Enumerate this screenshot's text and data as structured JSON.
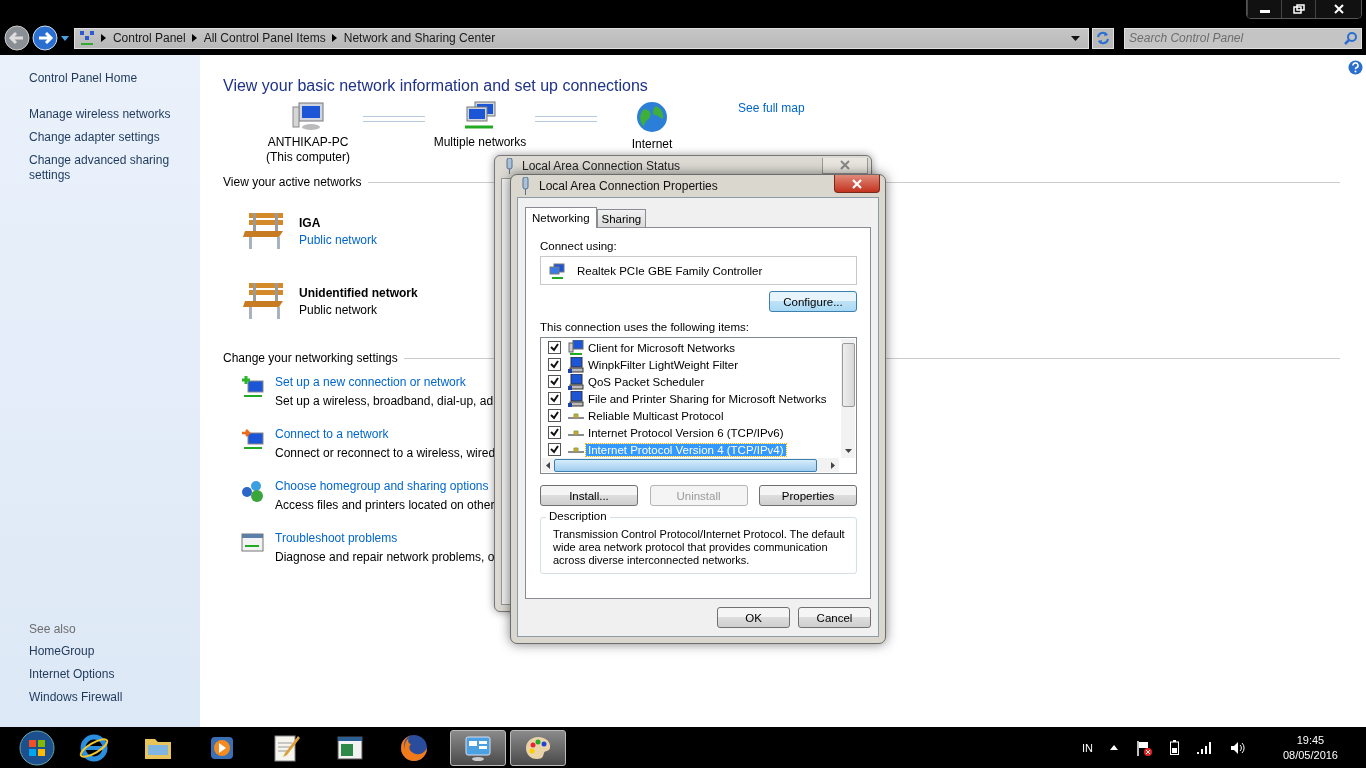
{
  "address_bar": {
    "breadcrumbs": [
      "Control Panel",
      "All Control Panel Items",
      "Network and Sharing Center"
    ]
  },
  "search": {
    "placeholder": "Search Control Panel"
  },
  "sidebar": {
    "items": [
      "Control Panel Home",
      "Manage wireless networks",
      "Change adapter settings",
      "Change advanced sharing settings"
    ],
    "see_also_title": "See also",
    "see_also": [
      "HomeGroup",
      "Internet Options",
      "Windows Firewall"
    ]
  },
  "main": {
    "heading": "View your basic network information and set up connections",
    "map": [
      {
        "kind": "computer",
        "name": "ANTHIKAP-PC",
        "sub": "(This computer)"
      },
      {
        "kind": "networks",
        "name": "Multiple networks"
      },
      {
        "kind": "globe",
        "name": "Internet"
      }
    ],
    "see_full_map": "See full map",
    "active_title": "View your active networks",
    "active_networks": [
      {
        "name": "IGA",
        "type": "Public network",
        "link": true
      },
      {
        "name": "Unidentified network",
        "type": "Public network",
        "link": false
      }
    ],
    "settings_title": "Change your networking settings",
    "tasks": [
      {
        "kind": "new",
        "title": "Set up a new connection or network",
        "desc": "Set up a wireless, broadband, dial-up, ad"
      },
      {
        "kind": "connect",
        "title": "Connect to a network",
        "desc": "Connect or reconnect to a wireless, wired"
      },
      {
        "kind": "homegroup",
        "title": "Choose homegroup and sharing options",
        "desc": "Access files and printers located on other"
      },
      {
        "kind": "troubleshoot",
        "title": "Troubleshoot problems",
        "desc": "Diagnose and repair network problems, o"
      }
    ]
  },
  "status_window": {
    "title": "Local Area Connection Status"
  },
  "dialog": {
    "title": "Local Area Connection Properties",
    "tabs": [
      {
        "label": "Networking",
        "selected": true
      },
      {
        "label": "Sharing",
        "selected": false
      }
    ],
    "connect_using_label": "Connect using:",
    "adapter": "Realtek PCIe GBE Family Controller",
    "configure": "Configure...",
    "items_label": "This connection uses the following items:",
    "items": [
      {
        "kind": "client",
        "label": "Client for Microsoft Networks",
        "checked": true,
        "selected": false
      },
      {
        "kind": "service",
        "label": "WinpkFilter LightWeight Filter",
        "checked": true,
        "selected": false
      },
      {
        "kind": "service",
        "label": "QoS Packet Scheduler",
        "checked": true,
        "selected": false
      },
      {
        "kind": "service",
        "label": "File and Printer Sharing for Microsoft Networks",
        "checked": true,
        "selected": false
      },
      {
        "kind": "protocol",
        "label": "Reliable Multicast Protocol",
        "checked": true,
        "selected": false
      },
      {
        "kind": "protocol",
        "label": "Internet Protocol Version 6 (TCP/IPv6)",
        "checked": true,
        "selected": false
      },
      {
        "kind": "protocol",
        "label": "Internet Protocol Version 4 (TCP/IPv4)",
        "checked": true,
        "selected": true
      }
    ],
    "buttons": [
      {
        "label": "Install...",
        "disabled": false
      },
      {
        "label": "Uninstall",
        "disabled": true
      },
      {
        "label": "Properties",
        "disabled": false
      }
    ],
    "description_title": "Description",
    "description": "Transmission Control Protocol/Internet Protocol. The default wide area network protocol that provides communication across diverse interconnected networks.",
    "footer_buttons": [
      "OK",
      "Cancel"
    ]
  },
  "taskbar": {
    "apps": [
      {
        "kind": "ie",
        "active": false
      },
      {
        "kind": "folder",
        "active": false
      },
      {
        "kind": "media",
        "active": false
      },
      {
        "kind": "notepad",
        "active": false
      },
      {
        "kind": "window",
        "active": false
      },
      {
        "kind": "firefox",
        "active": false
      },
      {
        "kind": "controlpanel",
        "active": true
      },
      {
        "kind": "paint",
        "active": true
      }
    ],
    "language": "IN",
    "time": "19:45",
    "date": "08/05/2016"
  }
}
